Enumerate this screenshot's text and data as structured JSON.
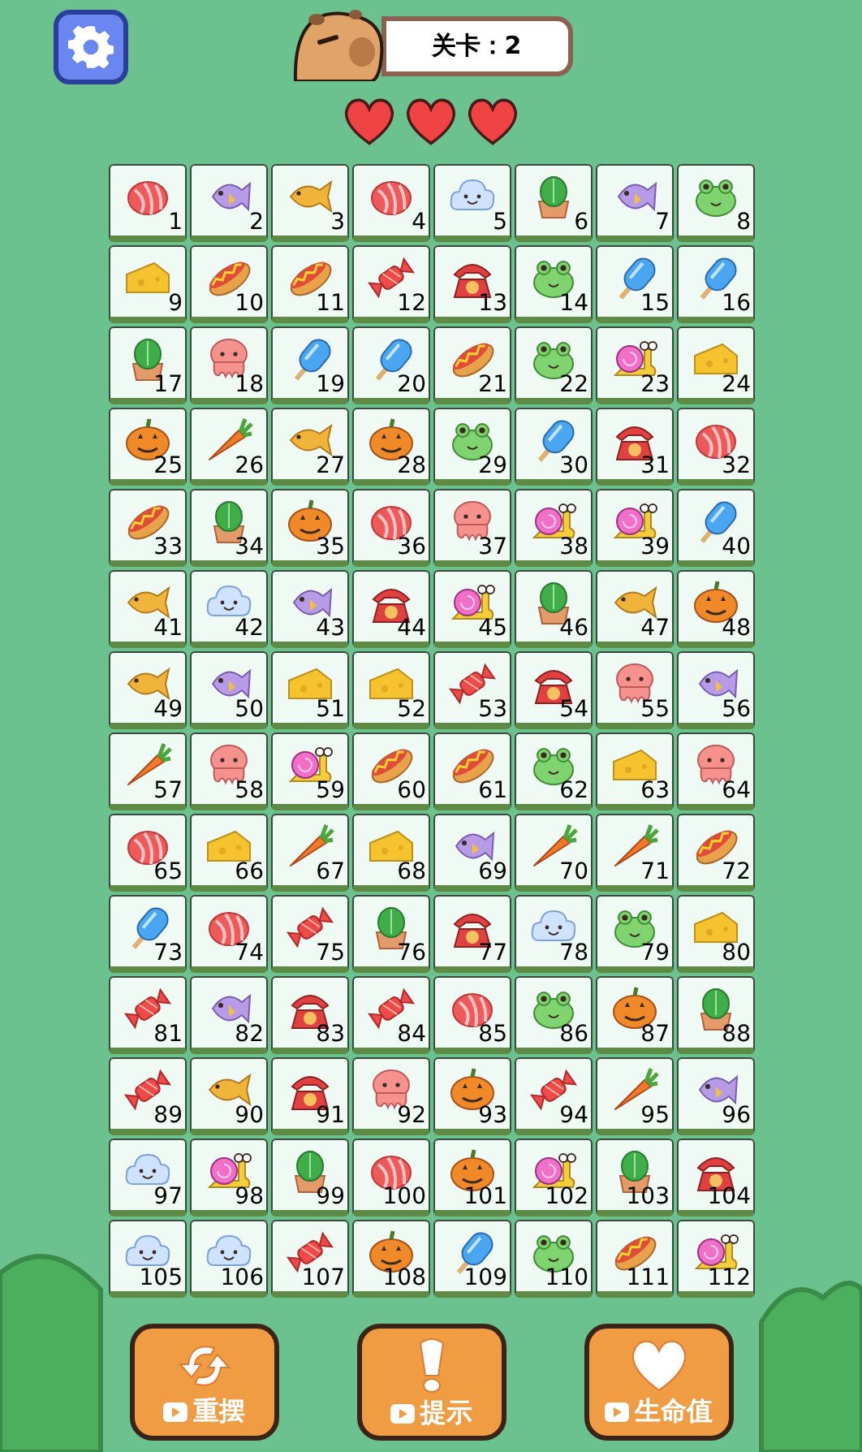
{
  "header": {
    "level_label": "关卡：2"
  },
  "lives": [
    {
      "filled": true
    },
    {
      "filled": true
    },
    {
      "filled": true
    }
  ],
  "tiles": [
    {
      "number": "1",
      "kind": "shell"
    },
    {
      "number": "2",
      "kind": "fish"
    },
    {
      "number": "3",
      "kind": "taiyaki"
    },
    {
      "number": "4",
      "kind": "shell"
    },
    {
      "number": "5",
      "kind": "cloud"
    },
    {
      "number": "6",
      "kind": "cactus"
    },
    {
      "number": "7",
      "kind": "fish"
    },
    {
      "number": "8",
      "kind": "frog"
    },
    {
      "number": "9",
      "kind": "cheese"
    },
    {
      "number": "10",
      "kind": "hotdog"
    },
    {
      "number": "11",
      "kind": "hotdog"
    },
    {
      "number": "12",
      "kind": "candy"
    },
    {
      "number": "13",
      "kind": "phone"
    },
    {
      "number": "14",
      "kind": "frog"
    },
    {
      "number": "15",
      "kind": "popsicle"
    },
    {
      "number": "16",
      "kind": "popsicle"
    },
    {
      "number": "17",
      "kind": "cactus"
    },
    {
      "number": "18",
      "kind": "octopus"
    },
    {
      "number": "19",
      "kind": "popsicle"
    },
    {
      "number": "20",
      "kind": "popsicle"
    },
    {
      "number": "21",
      "kind": "hotdog"
    },
    {
      "number": "22",
      "kind": "frog"
    },
    {
      "number": "23",
      "kind": "snail"
    },
    {
      "number": "24",
      "kind": "cheese"
    },
    {
      "number": "25",
      "kind": "pumpkin"
    },
    {
      "number": "26",
      "kind": "carrot"
    },
    {
      "number": "27",
      "kind": "taiyaki"
    },
    {
      "number": "28",
      "kind": "pumpkin"
    },
    {
      "number": "29",
      "kind": "frog"
    },
    {
      "number": "30",
      "kind": "popsicle"
    },
    {
      "number": "31",
      "kind": "phone"
    },
    {
      "number": "32",
      "kind": "shell"
    },
    {
      "number": "33",
      "kind": "hotdog"
    },
    {
      "number": "34",
      "kind": "cactus"
    },
    {
      "number": "35",
      "kind": "pumpkin"
    },
    {
      "number": "36",
      "kind": "shell"
    },
    {
      "number": "37",
      "kind": "octopus"
    },
    {
      "number": "38",
      "kind": "snail"
    },
    {
      "number": "39",
      "kind": "snail"
    },
    {
      "number": "40",
      "kind": "popsicle"
    },
    {
      "number": "41",
      "kind": "taiyaki"
    },
    {
      "number": "42",
      "kind": "cloud"
    },
    {
      "number": "43",
      "kind": "fish"
    },
    {
      "number": "44",
      "kind": "phone"
    },
    {
      "number": "45",
      "kind": "snail"
    },
    {
      "number": "46",
      "kind": "cactus"
    },
    {
      "number": "47",
      "kind": "taiyaki"
    },
    {
      "number": "48",
      "kind": "pumpkin"
    },
    {
      "number": "49",
      "kind": "taiyaki"
    },
    {
      "number": "50",
      "kind": "fish"
    },
    {
      "number": "51",
      "kind": "cheese"
    },
    {
      "number": "52",
      "kind": "cheese"
    },
    {
      "number": "53",
      "kind": "candy"
    },
    {
      "number": "54",
      "kind": "phone"
    },
    {
      "number": "55",
      "kind": "octopus"
    },
    {
      "number": "56",
      "kind": "fish"
    },
    {
      "number": "57",
      "kind": "carrot"
    },
    {
      "number": "58",
      "kind": "octopus"
    },
    {
      "number": "59",
      "kind": "snail"
    },
    {
      "number": "60",
      "kind": "hotdog"
    },
    {
      "number": "61",
      "kind": "hotdog"
    },
    {
      "number": "62",
      "kind": "frog"
    },
    {
      "number": "63",
      "kind": "cheese"
    },
    {
      "number": "64",
      "kind": "octopus"
    },
    {
      "number": "65",
      "kind": "shell"
    },
    {
      "number": "66",
      "kind": "cheese"
    },
    {
      "number": "67",
      "kind": "carrot"
    },
    {
      "number": "68",
      "kind": "cheese"
    },
    {
      "number": "69",
      "kind": "fish"
    },
    {
      "number": "70",
      "kind": "carrot"
    },
    {
      "number": "71",
      "kind": "carrot"
    },
    {
      "number": "72",
      "kind": "hotdog"
    },
    {
      "number": "73",
      "kind": "popsicle"
    },
    {
      "number": "74",
      "kind": "shell"
    },
    {
      "number": "75",
      "kind": "candy"
    },
    {
      "number": "76",
      "kind": "cactus"
    },
    {
      "number": "77",
      "kind": "phone"
    },
    {
      "number": "78",
      "kind": "cloud"
    },
    {
      "number": "79",
      "kind": "frog"
    },
    {
      "number": "80",
      "kind": "cheese"
    },
    {
      "number": "81",
      "kind": "candy"
    },
    {
      "number": "82",
      "kind": "fish"
    },
    {
      "number": "83",
      "kind": "phone"
    },
    {
      "number": "84",
      "kind": "candy"
    },
    {
      "number": "85",
      "kind": "shell"
    },
    {
      "number": "86",
      "kind": "frog"
    },
    {
      "number": "87",
      "kind": "pumpkin"
    },
    {
      "number": "88",
      "kind": "cactus"
    },
    {
      "number": "89",
      "kind": "candy"
    },
    {
      "number": "90",
      "kind": "taiyaki"
    },
    {
      "number": "91",
      "kind": "phone"
    },
    {
      "number": "92",
      "kind": "octopus"
    },
    {
      "number": "93",
      "kind": "pumpkin"
    },
    {
      "number": "94",
      "kind": "candy"
    },
    {
      "number": "95",
      "kind": "carrot"
    },
    {
      "number": "96",
      "kind": "fish"
    },
    {
      "number": "97",
      "kind": "cloud"
    },
    {
      "number": "98",
      "kind": "snail"
    },
    {
      "number": "99",
      "kind": "cactus"
    },
    {
      "number": "100",
      "kind": "shell"
    },
    {
      "number": "101",
      "kind": "pumpkin"
    },
    {
      "number": "102",
      "kind": "snail"
    },
    {
      "number": "103",
      "kind": "cactus"
    },
    {
      "number": "104",
      "kind": "phone"
    },
    {
      "number": "105",
      "kind": "cloud"
    },
    {
      "number": "106",
      "kind": "cloud"
    },
    {
      "number": "107",
      "kind": "candy"
    },
    {
      "number": "108",
      "kind": "pumpkin"
    },
    {
      "number": "109",
      "kind": "popsicle"
    },
    {
      "number": "110",
      "kind": "frog"
    },
    {
      "number": "111",
      "kind": "hotdog"
    },
    {
      "number": "112",
      "kind": "snail"
    }
  ],
  "buttons": [
    {
      "label": "重摆",
      "kind": "shuffle"
    },
    {
      "label": "提示",
      "kind": "hint"
    },
    {
      "label": "生命值",
      "kind": "life"
    }
  ]
}
